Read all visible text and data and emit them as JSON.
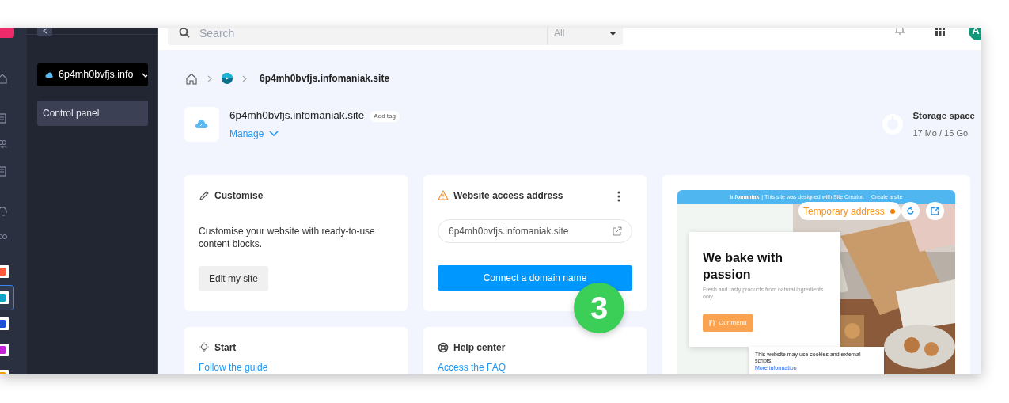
{
  "rail": {
    "apps": [
      {
        "selected": false
      },
      {
        "selected": true
      },
      {
        "selected": false
      },
      {
        "selected": false
      },
      {
        "selected": false
      }
    ]
  },
  "sidebar": {
    "domain_selector": "6p4mh0bvfjs.info",
    "items": [
      {
        "label": "Control panel",
        "selected": true
      }
    ]
  },
  "top_bar": {
    "search": {
      "placeholder": "Search"
    },
    "filter": "All",
    "avatar": "A"
  },
  "breadcrumb": [
    "6p4mh0bvfjs.infomaniak.site"
  ],
  "site": {
    "title": "6p4mh0bvfjs.infomaniak.site",
    "tag_button": "Add tag",
    "manage": "Manage"
  },
  "storage": {
    "label": "Storage space",
    "value": "17 Mo / 15 Go"
  },
  "cards": [
    {
      "kind": "customise",
      "title": "Customise",
      "text": "Customise your website with ready-to-use content blocks.",
      "button": "Edit my site"
    },
    {
      "kind": "access",
      "title": "Website access address",
      "address": "6p4mh0bvfjs.infomaniak.site",
      "button": "Connect a domain name"
    },
    {
      "kind": "start",
      "title": "Start",
      "link": "Follow the guide"
    },
    {
      "kind": "help",
      "title": "Help center",
      "link": "Access the FAQ"
    }
  ],
  "preview": {
    "banner_brand": "infomaniak",
    "banner_text": "| This site was designed with Site Creator.",
    "banner_link": "Create a site",
    "status": "Temporary address",
    "heading": "We bake with passion",
    "subtext": "Fresh and tasty products from natural ingredients only.",
    "button": "Our menu",
    "cookie_text": "This website may use cookies and external scripts.",
    "cookie_link": "More information"
  },
  "step_badge": "3"
}
